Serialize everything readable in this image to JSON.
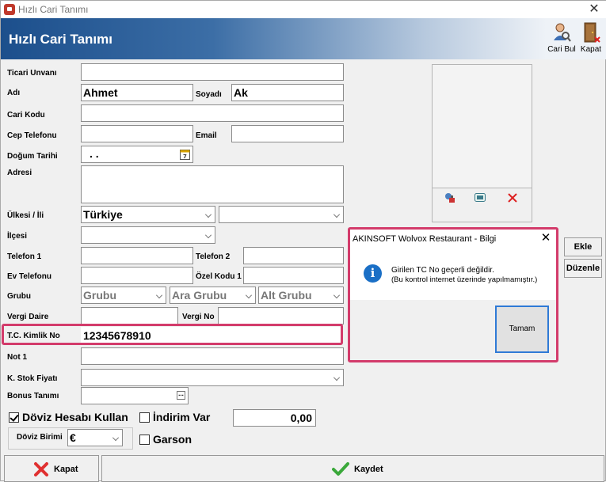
{
  "window": {
    "title": "Hızlı Cari Tanımı"
  },
  "header": {
    "title": "Hızlı Cari Tanımı",
    "cari_bul": "Cari Bul",
    "kapat": "Kapat"
  },
  "labels": {
    "ticari_unvani": "Ticari Unvanı",
    "adi": "Adı",
    "soyadi": "Soyadı",
    "cari_kodu": "Cari Kodu",
    "cep_telefonu": "Cep Telefonu",
    "email": "Email",
    "dogum_tarihi": "Doğum Tarihi",
    "adresi": "Adresi",
    "ulkesi_ili": "Ülkesi / İli",
    "ilcesi": "İlçesi",
    "telefon1": "Telefon 1",
    "telefon2": "Telefon 2",
    "ev_telefonu": "Ev Telefonu",
    "ozel_kodu1": "Özel Kodu 1",
    "grubu": "Grubu",
    "vergi_daire": "Vergi Daire",
    "vergi_no": "Vergi No",
    "tc_kimlik_no": "T.C. Kimlik No",
    "not1": "Not 1",
    "k_stok_fiyati": "K. Stok Fiyatı",
    "bonus_tanimi": "Bonus Tanımı",
    "doviz_birimi": "Döviz Birimi"
  },
  "values": {
    "adi": "Ahmet",
    "soyadi": "Ak",
    "dogum_tarihi": ". .",
    "ulkesi": "Türkiye",
    "grubu": "Grubu",
    "ara_grubu": "Ara Grubu",
    "alt_grubu": "Alt Grubu",
    "tc_kimlik_no": "12345678910",
    "doviz_birimi": "€",
    "indirim_value": "0,00"
  },
  "checks": {
    "doviz_hesabi": {
      "label": "Döviz Hesabı Kullan",
      "checked": true
    },
    "indirim_var": {
      "label": "İndirim Var",
      "checked": false
    },
    "garson": {
      "label": "Garson",
      "checked": false
    }
  },
  "side": {
    "ekle": "Ekle",
    "duzenle": "Düzenle"
  },
  "bottom": {
    "kapat": "Kapat",
    "kaydet": "Kaydet"
  },
  "dialog": {
    "title": "AKINSOFT Wolvox Restaurant - Bilgi",
    "message": "Girilen TC No geçerli değildir.",
    "note": "(Bu kontrol internet üzerinde yapılmamıştır.)",
    "ok": "Tamam"
  },
  "icons": {
    "app": "restaurant-app-icon",
    "cari_bul": "person-search-icon",
    "kapat": "door-exit-icon",
    "calendar": "calendar-icon",
    "photo_load": "photo-load-icon",
    "photo_camera": "webcam-icon",
    "photo_delete": "delete-x-icon",
    "info": "info-icon"
  },
  "colors": {
    "highlight": "#d33b6b",
    "header": "#1c4f8c",
    "info": "#1a6fc6",
    "ok_border": "#2f7ad6"
  }
}
